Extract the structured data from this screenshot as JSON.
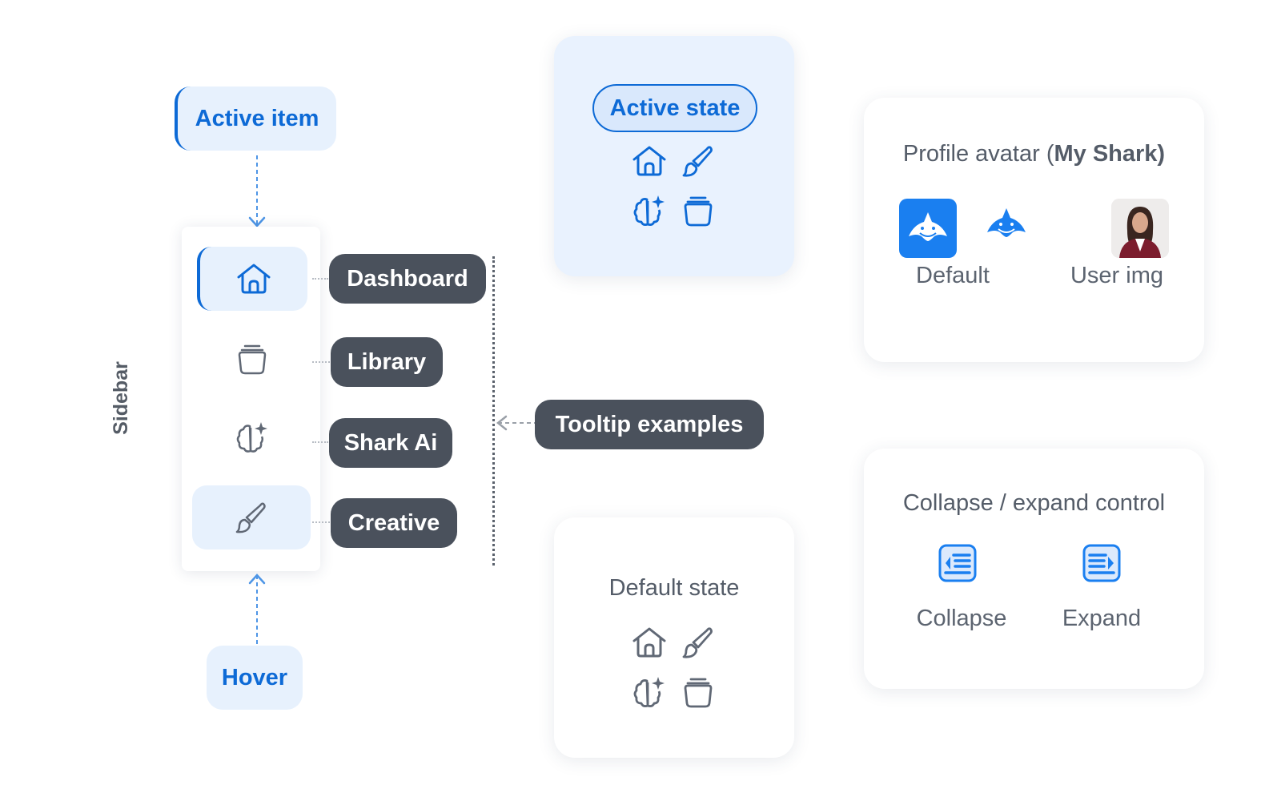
{
  "labels": {
    "active_item": "Active item",
    "hover": "Hover",
    "sidebar": "Sidebar"
  },
  "tooltips": {
    "dashboard": "Dashboard",
    "library": "Library",
    "shark_ai": "Shark Ai",
    "creative": "Creative",
    "examples": "Tooltip examples"
  },
  "active_card": {
    "pill": "Active state"
  },
  "default_card": {
    "title": "Default state"
  },
  "profile_card": {
    "title_prefix": "Profile avatar (",
    "title_bold": "My Shark)",
    "default_label": "Default",
    "user_label": "User img"
  },
  "collapse_card": {
    "title": "Collapse / expand control",
    "collapse_label": "Collapse",
    "expand_label": "Expand"
  },
  "colors": {
    "accent": "#0d6ad6",
    "accent_light": "#e7f1fd",
    "tooltip_bg": "#4a515c",
    "icon_gray": "#606875"
  },
  "icons": [
    "home-icon",
    "library-icon",
    "brain-sparkle-icon",
    "brush-icon",
    "shark-icon",
    "collapse-icon",
    "expand-icon"
  ]
}
